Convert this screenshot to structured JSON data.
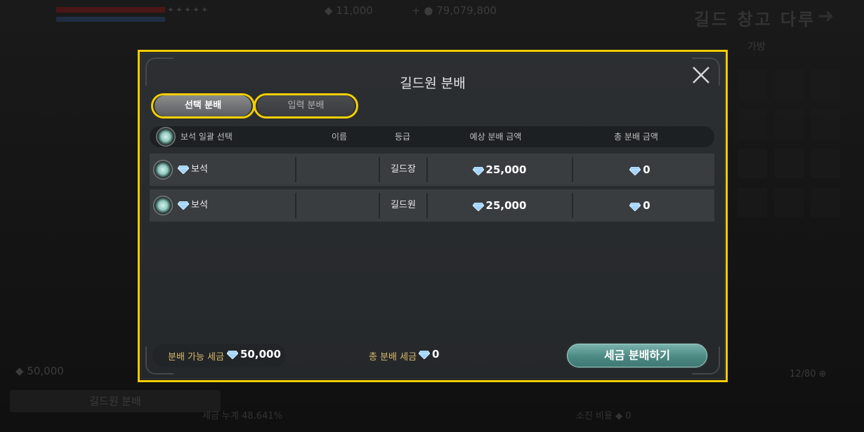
{
  "background": {
    "top_resource_1": "11,000",
    "top_resource_2": "79,079,800",
    "top_title": "길드 창고 다루",
    "sub_tab": "가방",
    "left_amount": "50,000",
    "left_button": "길드원 분배",
    "bottom_left_text": "세금 누계",
    "bottom_left_value": "48.641%",
    "bottom_right_text": "소진 비용",
    "bottom_right_value": "0",
    "slot_count": "12/80"
  },
  "modal": {
    "title": "길드원 분배",
    "tabs": [
      {
        "label": "선택 분배",
        "active": true
      },
      {
        "label": "입력 분배",
        "active": false
      }
    ],
    "header": {
      "select_all": "보석 일괄 선택",
      "col_name": "이름",
      "col_rank": "등급",
      "col_expected": "예상 분배 금액",
      "col_total": "총 분배 금액"
    },
    "rows": [
      {
        "currency": "보석",
        "name": "",
        "rank": "길드장",
        "expected": "25,000",
        "total": "0"
      },
      {
        "currency": "보석",
        "name": "",
        "rank": "길드원",
        "expected": "25,000",
        "total": "0"
      }
    ],
    "footer": {
      "available_label": "분배 가능 세금",
      "available_value": "50,000",
      "total_label": "총 분배 세금",
      "total_value": "0",
      "distribute_button": "세금 분배하기"
    }
  },
  "colors": {
    "highlight": "#f5cf00",
    "accent_teal": "#4c8983",
    "gold_label": "#d9b96b",
    "gem": "#9fd3ff"
  },
  "icons": {
    "close": "close-icon",
    "gem": "diamond-gem-icon",
    "radio": "radio-select-icon"
  }
}
